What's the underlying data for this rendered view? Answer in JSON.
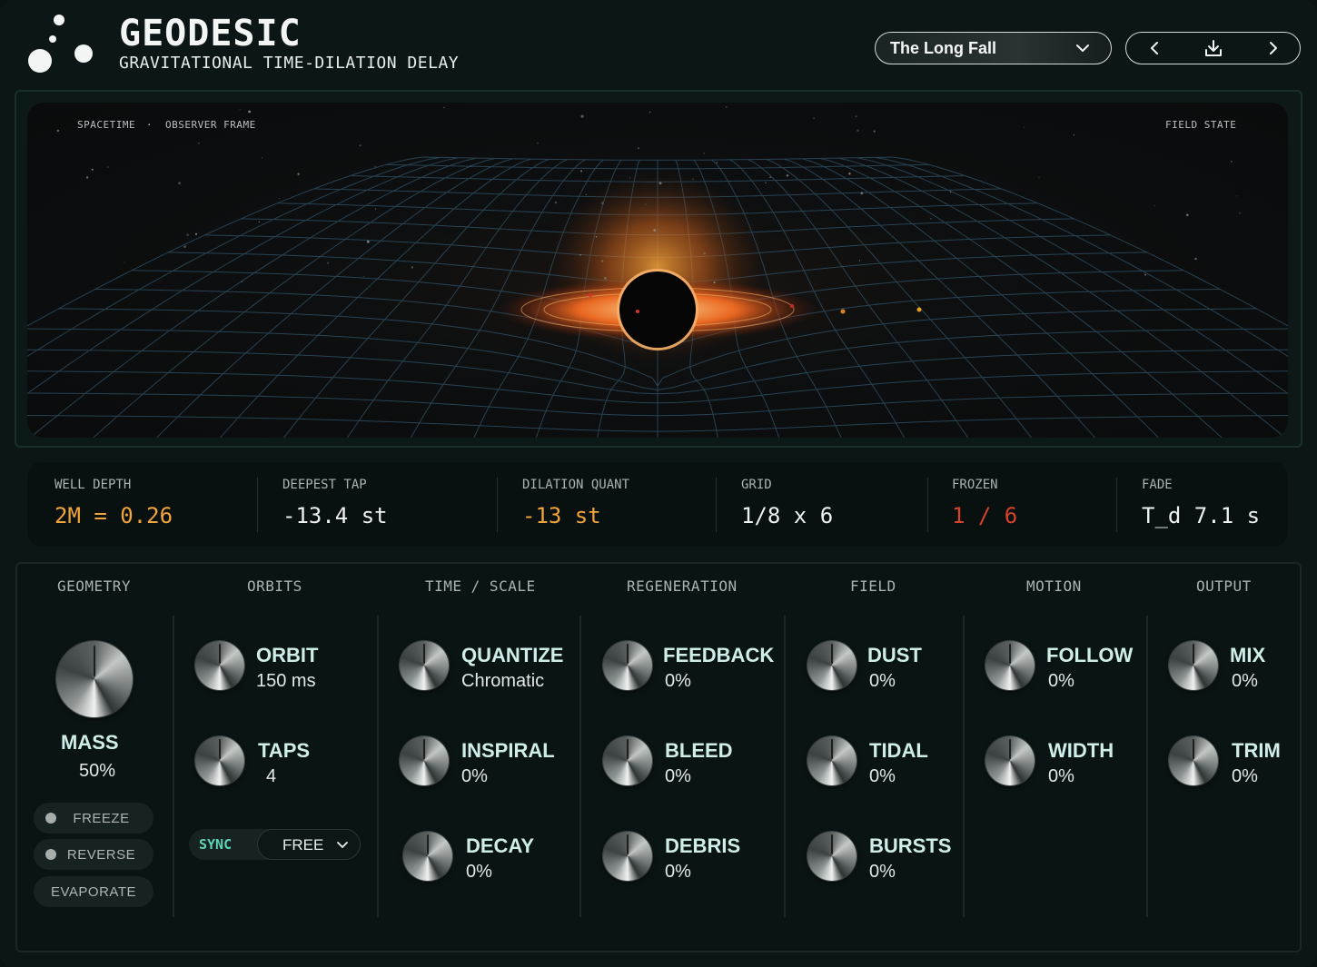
{
  "header": {
    "title": "GEODESIC",
    "subtitle": "GRAVITATIONAL TIME-DILATION DELAY",
    "logo_icon": "orbiting-dots-logo",
    "preset_name": "The Long Fall",
    "nav_icons": [
      "chevron-left-icon",
      "download-icon",
      "chevron-right-icon"
    ]
  },
  "visualizer": {
    "label_left_1": "SPACETIME",
    "label_sep": "·",
    "label_left_2": "OBSERVER FRAME",
    "label_right": "FIELD STATE"
  },
  "readouts": [
    {
      "label": "WELL DEPTH",
      "value": "2M = 0.26",
      "color": "#f2a53a"
    },
    {
      "label": "DEEPEST TAP",
      "value": "-13.4 st",
      "color": "#eef1ef"
    },
    {
      "label": "DILATION QUANT",
      "value": "-13 st",
      "color": "#f2a53a"
    },
    {
      "label": "GRID",
      "value": "1/8 x 6",
      "color": "#eef1ef"
    },
    {
      "label": "FROZEN",
      "value": "1 / 6",
      "color": "#d8432c"
    },
    {
      "label": "FADE",
      "value": "T_d 7.1 s",
      "color": "#eef1ef"
    }
  ],
  "sections": {
    "geometry": "GEOMETRY",
    "orbits": "ORBITS",
    "time_scale": "TIME / SCALE",
    "regeneration": "REGENERATION",
    "field": "FIELD",
    "motion": "MOTION",
    "output": "OUTPUT"
  },
  "geometry": {
    "mass": {
      "name": "MASS",
      "value": "50%"
    },
    "freeze": "FREEZE",
    "reverse": "REVERSE",
    "evaporate": "EVAPORATE"
  },
  "orbits": {
    "orbit": {
      "name": "ORBIT",
      "value": "150 ms"
    },
    "taps": {
      "name": "TAPS",
      "value": "4"
    },
    "sync_label": "SYNC",
    "sync_mode": "FREE"
  },
  "time_scale": {
    "quantize": {
      "name": "QUANTIZE",
      "value": "Chromatic"
    },
    "inspiral": {
      "name": "INSPIRAL",
      "value": "0%"
    },
    "decay": {
      "name": "DECAY",
      "value": "0%"
    }
  },
  "regeneration": {
    "feedback": {
      "name": "FEEDBACK",
      "value": "0%"
    },
    "bleed": {
      "name": "BLEED",
      "value": "0%"
    },
    "debris": {
      "name": "DEBRIS",
      "value": "0%"
    }
  },
  "field": {
    "dust": {
      "name": "DUST",
      "value": "0%"
    },
    "tidal": {
      "name": "TIDAL",
      "value": "0%"
    },
    "bursts": {
      "name": "BURSTS",
      "value": "0%"
    }
  },
  "motion": {
    "follow": {
      "name": "FOLLOW",
      "value": "0%"
    },
    "width": {
      "name": "WIDTH",
      "value": "0%"
    }
  },
  "output": {
    "mix": {
      "name": "MIX",
      "value": "0%"
    },
    "trim": {
      "name": "TRIM",
      "value": "0%"
    }
  }
}
